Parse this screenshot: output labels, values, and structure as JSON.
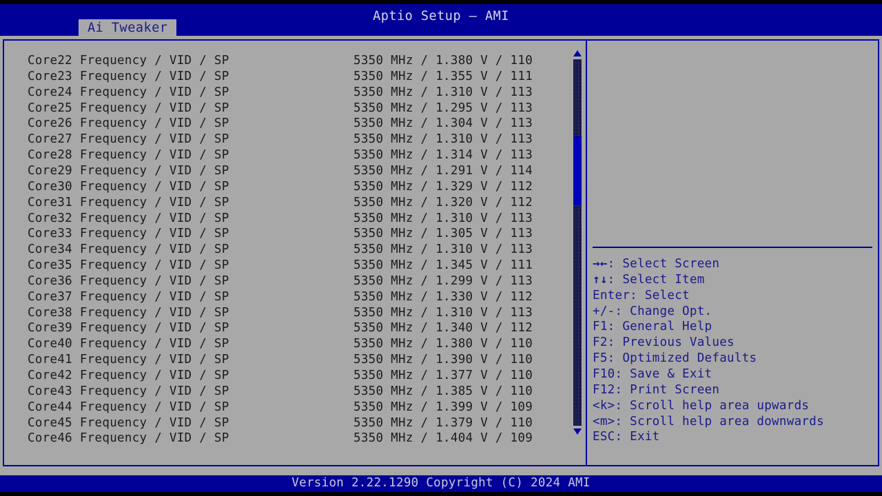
{
  "window": {
    "title": "Aptio Setup – AMI"
  },
  "tabs": [
    {
      "label": "Ai Tweaker",
      "active": true
    }
  ],
  "list": {
    "rows": [
      {
        "label": "Core22 Frequency / VID / SP",
        "value": "5350 MHz / 1.380 V / 110"
      },
      {
        "label": "Core23 Frequency / VID / SP",
        "value": "5350 MHz / 1.355 V / 111"
      },
      {
        "label": "Core24 Frequency / VID / SP",
        "value": "5350 MHz / 1.310 V / 113"
      },
      {
        "label": "Core25 Frequency / VID / SP",
        "value": "5350 MHz / 1.295 V / 113"
      },
      {
        "label": "Core26 Frequency / VID / SP",
        "value": "5350 MHz / 1.304 V / 113"
      },
      {
        "label": "Core27 Frequency / VID / SP",
        "value": "5350 MHz / 1.310 V / 113"
      },
      {
        "label": "Core28 Frequency / VID / SP",
        "value": "5350 MHz / 1.314 V / 113"
      },
      {
        "label": "Core29 Frequency / VID / SP",
        "value": "5350 MHz / 1.291 V / 114"
      },
      {
        "label": "Core30 Frequency / VID / SP",
        "value": "5350 MHz / 1.329 V / 112"
      },
      {
        "label": "Core31 Frequency / VID / SP",
        "value": "5350 MHz / 1.320 V / 112"
      },
      {
        "label": "Core32 Frequency / VID / SP",
        "value": "5350 MHz / 1.310 V / 113"
      },
      {
        "label": "Core33 Frequency / VID / SP",
        "value": "5350 MHz / 1.305 V / 113"
      },
      {
        "label": "Core34 Frequency / VID / SP",
        "value": "5350 MHz / 1.310 V / 113"
      },
      {
        "label": "Core35 Frequency / VID / SP",
        "value": "5350 MHz / 1.345 V / 111"
      },
      {
        "label": "Core36 Frequency / VID / SP",
        "value": "5350 MHz / 1.299 V / 113"
      },
      {
        "label": "Core37 Frequency / VID / SP",
        "value": "5350 MHz / 1.330 V / 112"
      },
      {
        "label": "Core38 Frequency / VID / SP",
        "value": "5350 MHz / 1.310 V / 113"
      },
      {
        "label": "Core39 Frequency / VID / SP",
        "value": "5350 MHz / 1.340 V / 112"
      },
      {
        "label": "Core40 Frequency / VID / SP",
        "value": "5350 MHz / 1.380 V / 110"
      },
      {
        "label": "Core41 Frequency / VID / SP",
        "value": "5350 MHz / 1.390 V / 110"
      },
      {
        "label": "Core42 Frequency / VID / SP",
        "value": "5350 MHz / 1.377 V / 110"
      },
      {
        "label": "Core43 Frequency / VID / SP",
        "value": "5350 MHz / 1.385 V / 110"
      },
      {
        "label": "Core44 Frequency / VID / SP",
        "value": "5350 MHz / 1.399 V / 109"
      },
      {
        "label": "Core45 Frequency / VID / SP",
        "value": "5350 MHz / 1.379 V / 110"
      },
      {
        "label": "Core46 Frequency / VID / SP",
        "value": "5350 MHz / 1.404 V / 109"
      }
    ]
  },
  "scrollbar": {
    "up_arrow": "▲",
    "down_arrow": "▼"
  },
  "help": {
    "lines": [
      {
        "glyph": "→←",
        "text": ": Select Screen"
      },
      {
        "glyph": "↑↓",
        "text": ": Select Item"
      },
      {
        "glyph": "",
        "text": "Enter: Select"
      },
      {
        "glyph": "",
        "text": "+/-: Change Opt."
      },
      {
        "glyph": "",
        "text": "F1: General Help"
      },
      {
        "glyph": "",
        "text": "F2: Previous Values"
      },
      {
        "glyph": "",
        "text": "F5: Optimized Defaults"
      },
      {
        "glyph": "",
        "text": "F10: Save & Exit"
      },
      {
        "glyph": "",
        "text": "F12: Print Screen"
      },
      {
        "glyph": "",
        "text": "<k>: Scroll help area upwards"
      },
      {
        "glyph": "",
        "text": "<m>: Scroll help area downwards"
      },
      {
        "glyph": "",
        "text": "ESC: Exit"
      }
    ]
  },
  "footer": {
    "text": "Version 2.22.1290 Copyright (C) 2024 AMI"
  },
  "colors": {
    "bios_blue": "#000099",
    "panel_gray": "#a8a8a8",
    "border_blue": "#0000a0",
    "help_text_blue": "#1a1a8c",
    "item_text": "#1c1c1c",
    "thumb_blue": "#0000bb"
  }
}
